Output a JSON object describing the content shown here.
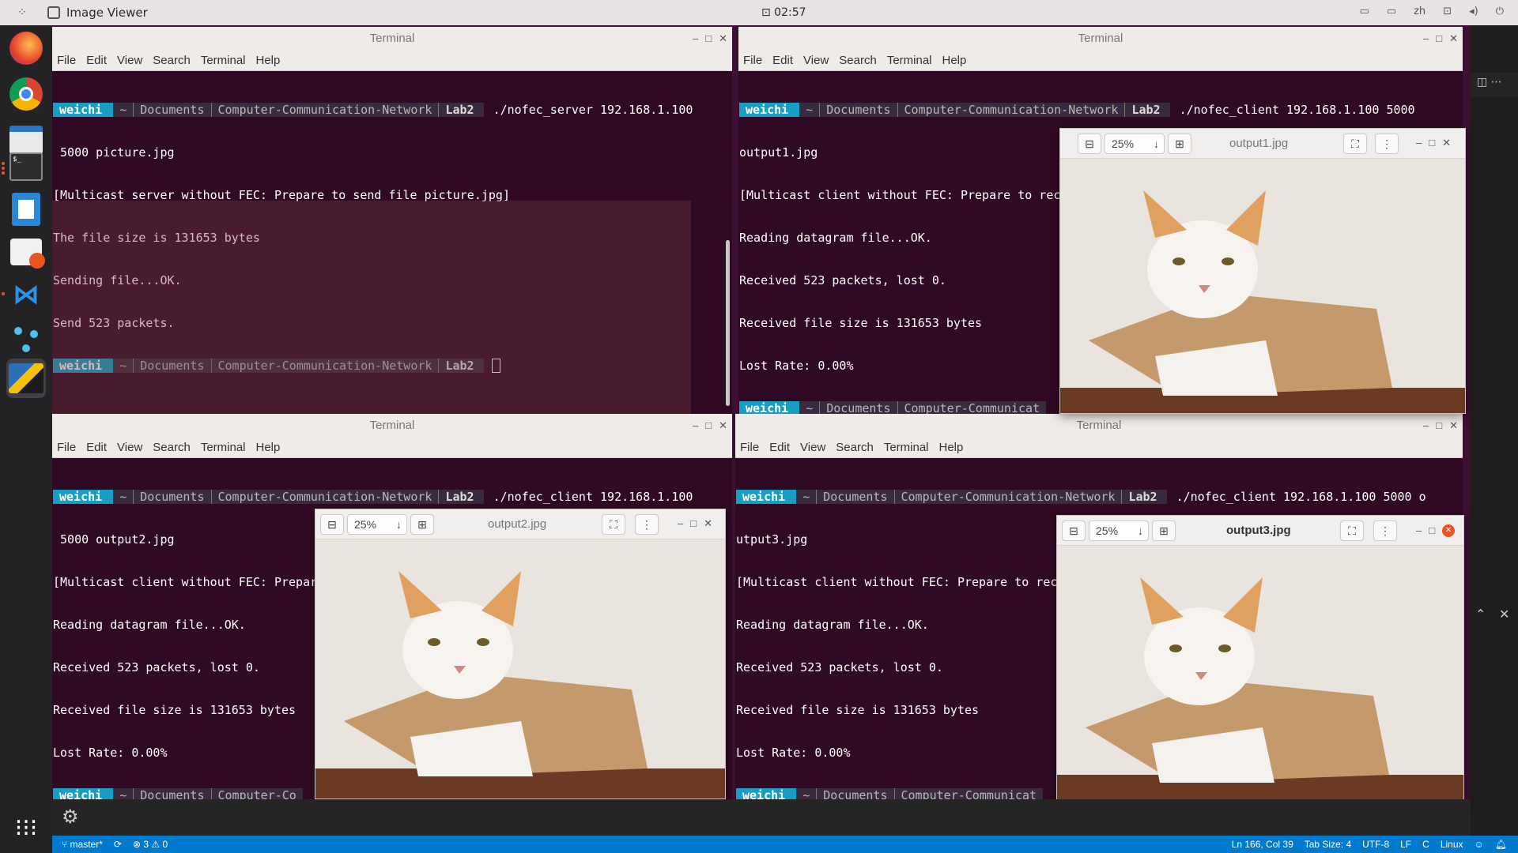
{
  "topbar": {
    "app_name": "Image Viewer",
    "clock": "⊡ 02:57",
    "lang": "zh"
  },
  "terminals": [
    {
      "title": "Terminal",
      "menu": [
        "File",
        "Edit",
        "View",
        "Search",
        "Terminal",
        "Help"
      ]
    },
    {
      "title": "Terminal",
      "menu": [
        "File",
        "Edit",
        "View",
        "Search",
        "Terminal",
        "Help"
      ]
    },
    {
      "title": "Terminal",
      "menu": [
        "File",
        "Edit",
        "View",
        "Search",
        "Terminal",
        "Help"
      ]
    },
    {
      "title": "Terminal",
      "menu": [
        "File",
        "Edit",
        "View",
        "Search",
        "Terminal",
        "Help"
      ]
    }
  ],
  "prompt": {
    "user": "weichi",
    "home": "~",
    "p1": "Documents",
    "p2": "Computer-Communication-Network",
    "p3": "Lab2",
    "p2_trunc_a": "Computer-Co",
    "p2_trunc_b": "Computer-Communicat"
  },
  "t1": {
    "cmd": "./nofec_server 192.168.1.100",
    "l1": " 5000 picture.jpg",
    "l2": "[Multicast server without FEC: Prepare to send file picture.jpg]",
    "l3": "The file size is 131653 bytes",
    "l4": "Sending file...OK.",
    "l5": "Send 523 packets."
  },
  "t2": {
    "cmd": "./nofec_client 192.168.1.100 5000",
    "l1": "output1.jpg",
    "l2": "[Multicast client without FEC: Prepare to receive file]",
    "l3": "Reading datagram file...OK.",
    "l4": "Received 523 packets, lost 0.",
    "l5": "Received file size is 131653 bytes",
    "l6": "Lost Rate: 0.00%"
  },
  "t3": {
    "cmd": "./nofec_client 192.168.1.100",
    "l1": " 5000 output2.jpg",
    "l2": "[Multicast client without FEC: Prepare to receive file]",
    "l3": "Reading datagram file...OK.",
    "l4": "Received 523 packets, lost 0.",
    "l5": "Received file size is 131653 bytes",
    "l6": "Lost Rate: 0.00%"
  },
  "t4": {
    "cmd": "./nofec_client 192.168.1.100 5000 o",
    "l1": "utput3.jpg",
    "l2": "[Multicast client without FEC: Prepare to receive file]",
    "l3": "Reading datagram file...OK.",
    "l4": "Received 523 packets, lost 0.",
    "l5": "Received file size is 131653 bytes",
    "l6": "Lost Rate: 0.00%"
  },
  "viewers": [
    {
      "title": "output1.jpg",
      "zoom": "25%"
    },
    {
      "title": "output2.jpg",
      "zoom": "25%"
    },
    {
      "title": "output3.jpg",
      "zoom": "25%"
    }
  ],
  "statusbar": {
    "branch": "master*",
    "errors": "3",
    "warnings": "0",
    "position": "Ln 166, Col 39",
    "tabsize": "Tab Size: 4",
    "encoding": "UTF-8",
    "eol": "LF",
    "lang": "C",
    "os": "Linux"
  },
  "colors": {
    "terminal_bg": "#300a24",
    "prompt_user": "#169fc3",
    "status_blue": "#007acc",
    "ubuntu_orange": "#e95420"
  }
}
